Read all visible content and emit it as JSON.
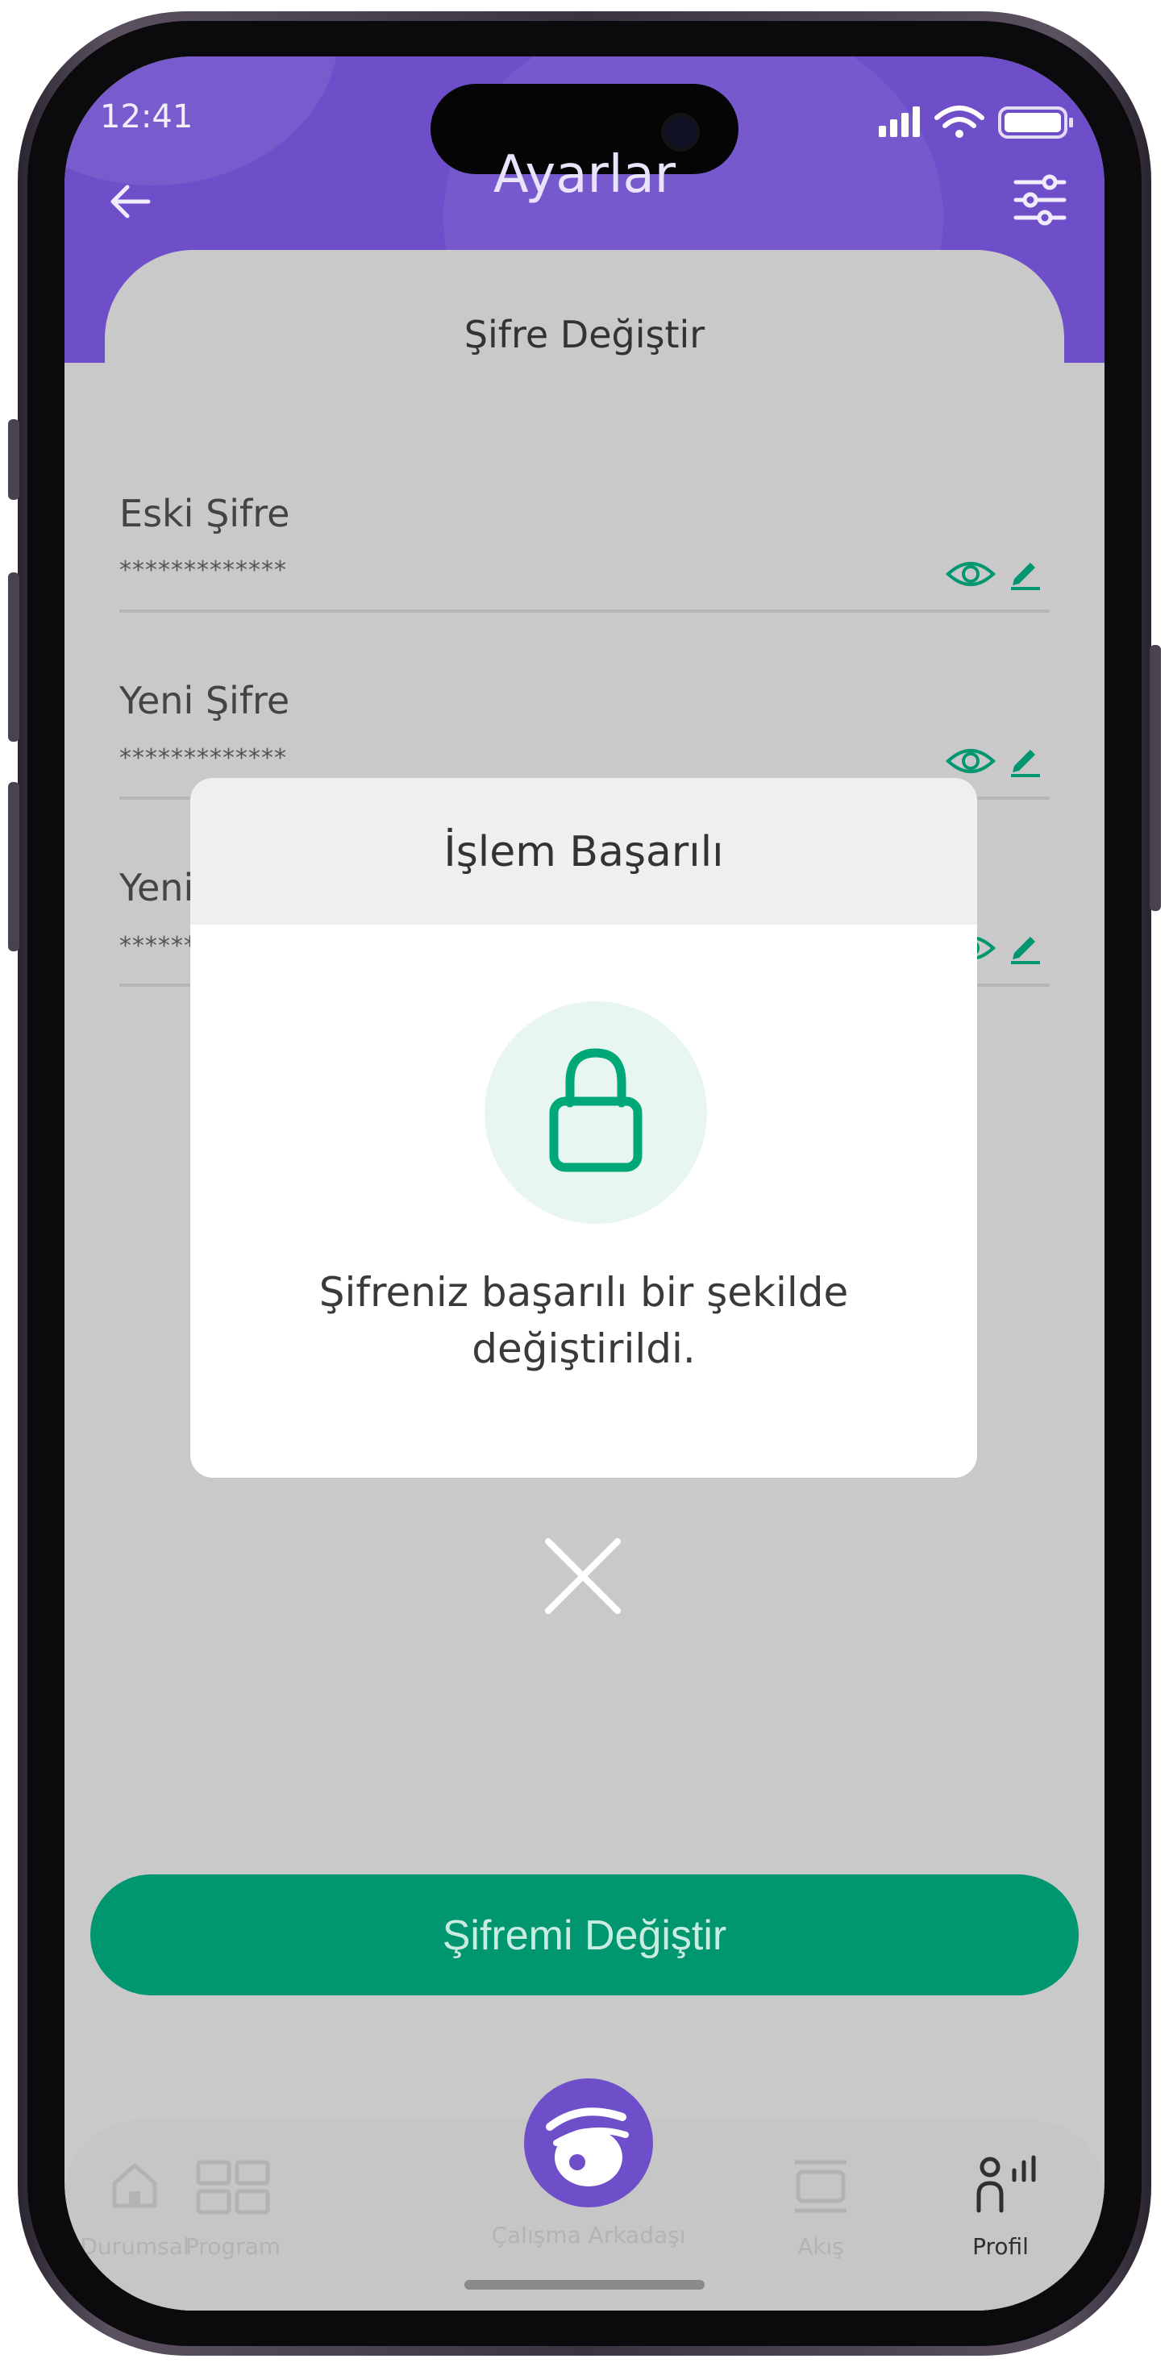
{
  "status_bar": {
    "time": "12:41"
  },
  "header": {
    "title": "Ayarlar"
  },
  "section": {
    "title": "Şifre Değiştir"
  },
  "fields": [
    {
      "label": "Eski Şifre",
      "value": "*************"
    },
    {
      "label": "Yeni Şifre",
      "value": "*************"
    },
    {
      "label": "Yeni",
      "value": "******"
    }
  ],
  "primary_button": {
    "label": "Şifremi Değiştir"
  },
  "tabbar": {
    "items": [
      {
        "label": "Durumsal",
        "icon": "home-icon",
        "active": false
      },
      {
        "label": "Program",
        "icon": "grid-icon",
        "active": false
      },
      {
        "label": "Çalışma Arkadaşı",
        "icon": "rabbit-logo-icon",
        "active": false
      },
      {
        "label": "Akış",
        "icon": "feed-icon",
        "active": false
      },
      {
        "label": "Profil",
        "icon": "profile-icon",
        "active": true
      }
    ]
  },
  "modal": {
    "title": "İşlem Başarılı",
    "message": "Şifreniz başarılı bir şekilde değiştirildi.",
    "icon": "lock-icon",
    "close_icon": "close-icon"
  },
  "colors": {
    "brand_purple": "#6e4fc9",
    "accent_green": "#009670",
    "overlay_gray": "#c9c9c9"
  }
}
